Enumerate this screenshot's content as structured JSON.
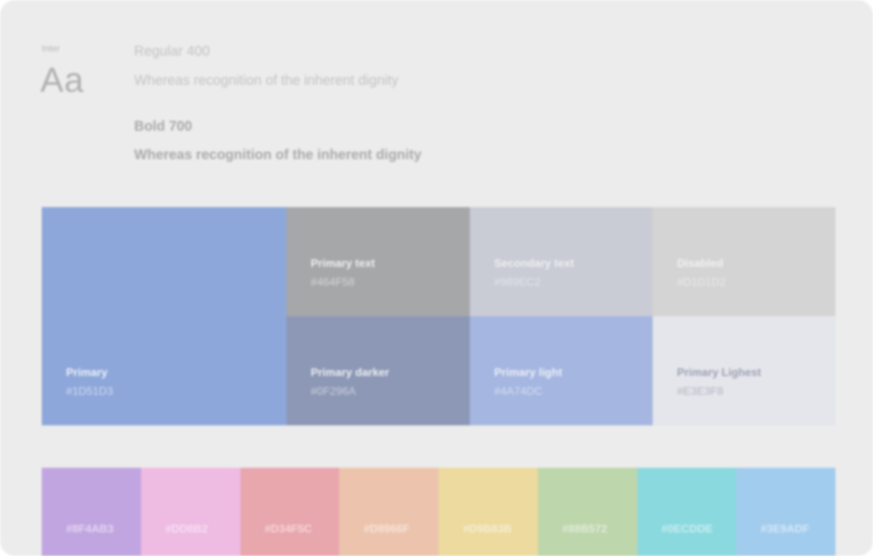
{
  "typography": {
    "font_name": "Inter",
    "sample": "Aa",
    "regular": {
      "label": "Regular 400",
      "text": "Whereas recognition of the inherent dignity"
    },
    "bold": {
      "label": "Bold 700",
      "text": "Whereas recognition of the inherent dignity"
    }
  },
  "palette": {
    "primary": {
      "name": "Primary",
      "hex": "#1D51D3",
      "color": "#8ea7da"
    },
    "primary_text": {
      "name": "Primary text",
      "hex": "#464F58",
      "color": "#a6a7a9"
    },
    "secondary_text": {
      "name": "Secondary text",
      "hex": "#989EC2",
      "color": "#c9ccd5"
    },
    "disabled": {
      "name": "Disabled",
      "hex": "#D1D1D2",
      "color": "#d4d4d4"
    },
    "primary_darker": {
      "name": "Primary darker",
      "hex": "#0F296A",
      "color": "#8c98b5"
    },
    "primary_light": {
      "name": "Primary light",
      "hex": "#4A74DC",
      "color": "#a5b6e0"
    },
    "primary_lighest": {
      "name": "Primary Lighest",
      "hex": "#E3E3F8",
      "color": "#e5e6eb"
    }
  },
  "extended_colors": [
    {
      "hex": "#8F4AB3",
      "color": "#c1a5e0"
    },
    {
      "hex": "#DD8B2",
      "color": "#eebbe3"
    },
    {
      "hex": "#D34F5C",
      "color": "#e8a6ad"
    },
    {
      "hex": "#D8966F",
      "color": "#ecc4ad"
    },
    {
      "hex": "#D9B83B",
      "color": "#ecda9e"
    },
    {
      "hex": "#88B572",
      "color": "#bdd6ab"
    },
    {
      "hex": "#0ECDDE",
      "color": "#8ad9df"
    },
    {
      "hex": "#3E9ADF",
      "color": "#a2cced"
    }
  ]
}
